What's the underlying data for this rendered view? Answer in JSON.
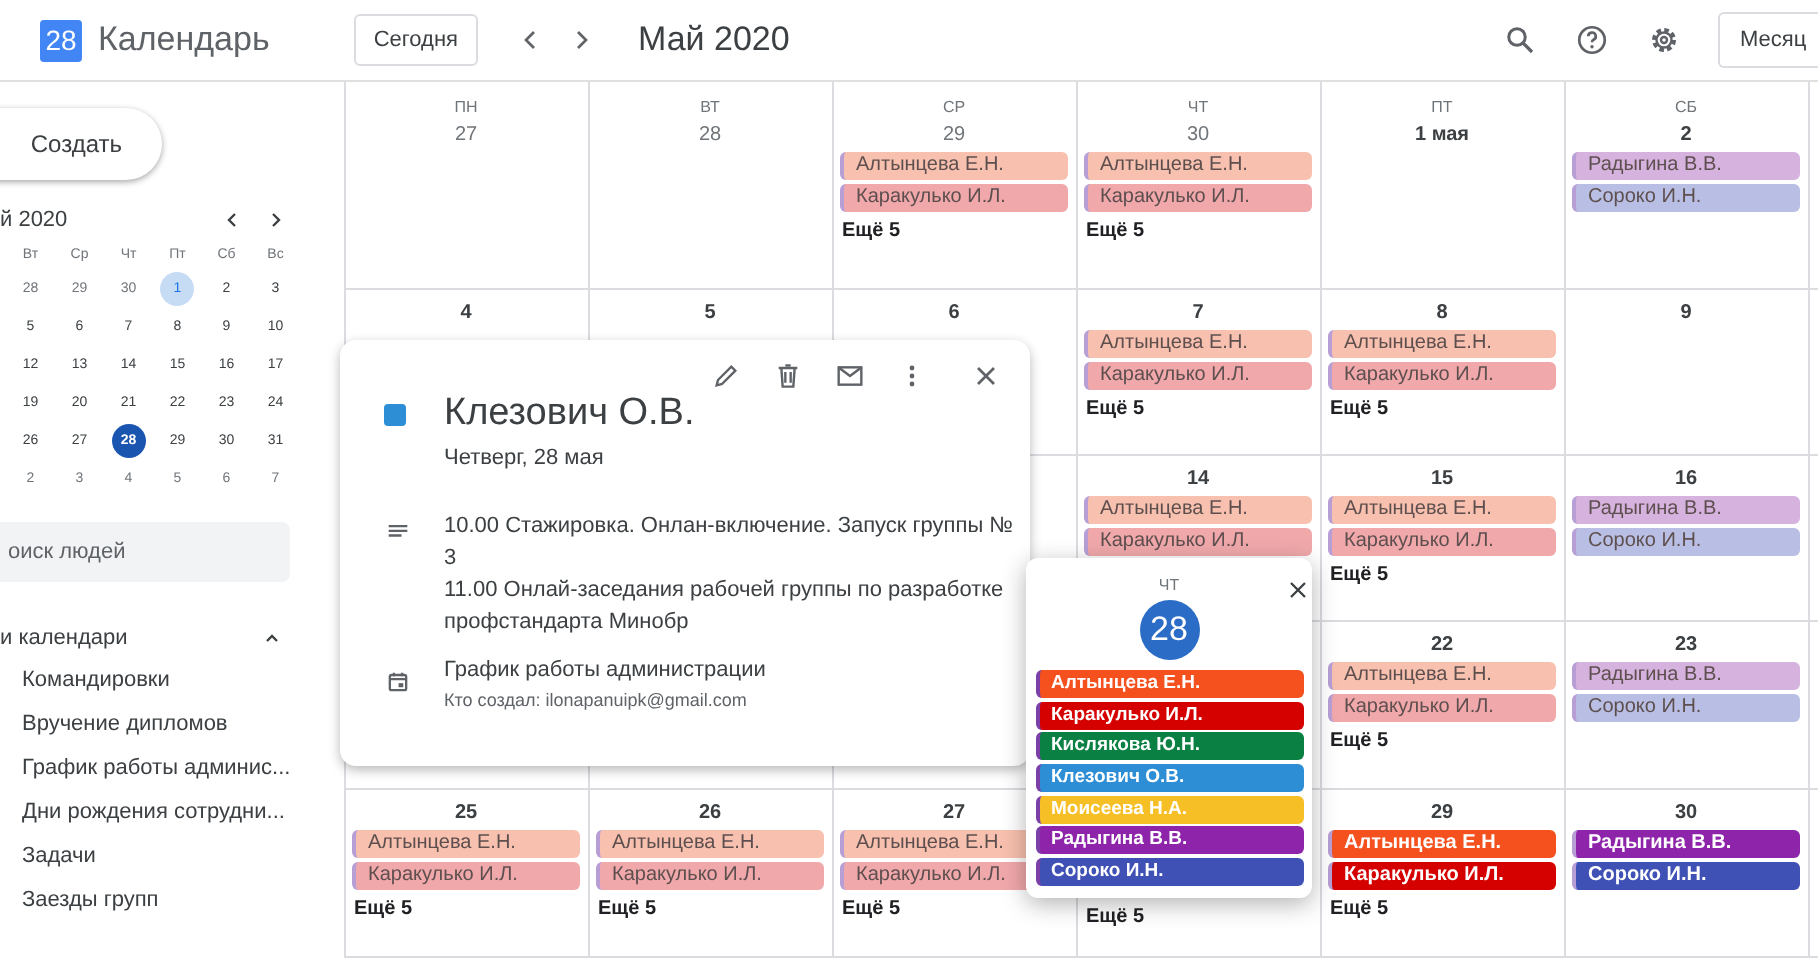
{
  "header": {
    "logo_day": "28",
    "app_title": "Календарь",
    "today_button": "Сегодня",
    "period": "Май 2020",
    "view_button": "Месяц"
  },
  "sidebar": {
    "create_button": "Создать",
    "mini_calendar": {
      "title": "й 2020",
      "weekdays": [
        "Вт",
        "Ср",
        "Чт",
        "Пт",
        "Сб",
        "Вс"
      ],
      "weeks": [
        [
          {
            "label": "28",
            "muted": true,
            "today": false,
            "selected": false
          },
          {
            "label": "29",
            "muted": true,
            "today": false,
            "selected": false
          },
          {
            "label": "30",
            "muted": true,
            "today": false,
            "selected": false
          },
          {
            "label": "1",
            "muted": false,
            "today": true,
            "selected": false
          },
          {
            "label": "2",
            "muted": false,
            "today": false,
            "selected": false
          },
          {
            "label": "3",
            "muted": false,
            "today": false,
            "selected": false
          }
        ],
        [
          {
            "label": "5",
            "muted": false,
            "today": false,
            "selected": false
          },
          {
            "label": "6",
            "muted": false,
            "today": false,
            "selected": false
          },
          {
            "label": "7",
            "muted": false,
            "today": false,
            "selected": false
          },
          {
            "label": "8",
            "muted": false,
            "today": false,
            "selected": false
          },
          {
            "label": "9",
            "muted": false,
            "today": false,
            "selected": false
          },
          {
            "label": "10",
            "muted": false,
            "today": false,
            "selected": false
          }
        ],
        [
          {
            "label": "12",
            "muted": false,
            "today": false,
            "selected": false
          },
          {
            "label": "13",
            "muted": false,
            "today": false,
            "selected": false
          },
          {
            "label": "14",
            "muted": false,
            "today": false,
            "selected": false
          },
          {
            "label": "15",
            "muted": false,
            "today": false,
            "selected": false
          },
          {
            "label": "16",
            "muted": false,
            "today": false,
            "selected": false
          },
          {
            "label": "17",
            "muted": false,
            "today": false,
            "selected": false
          }
        ],
        [
          {
            "label": "19",
            "muted": false,
            "today": false,
            "selected": false
          },
          {
            "label": "20",
            "muted": false,
            "today": false,
            "selected": false
          },
          {
            "label": "21",
            "muted": false,
            "today": false,
            "selected": false
          },
          {
            "label": "22",
            "muted": false,
            "today": false,
            "selected": false
          },
          {
            "label": "23",
            "muted": false,
            "today": false,
            "selected": false
          },
          {
            "label": "24",
            "muted": false,
            "today": false,
            "selected": false
          }
        ],
        [
          {
            "label": "26",
            "muted": false,
            "today": false,
            "selected": false
          },
          {
            "label": "27",
            "muted": false,
            "today": false,
            "selected": false
          },
          {
            "label": "28",
            "muted": false,
            "today": false,
            "selected": true
          },
          {
            "label": "29",
            "muted": false,
            "today": false,
            "selected": false
          },
          {
            "label": "30",
            "muted": false,
            "today": false,
            "selected": false
          },
          {
            "label": "31",
            "muted": false,
            "today": false,
            "selected": false
          }
        ],
        [
          {
            "label": "2",
            "muted": true,
            "today": false,
            "selected": false
          },
          {
            "label": "3",
            "muted": true,
            "today": false,
            "selected": false
          },
          {
            "label": "4",
            "muted": true,
            "today": false,
            "selected": false
          },
          {
            "label": "5",
            "muted": true,
            "today": false,
            "selected": false
          },
          {
            "label": "6",
            "muted": true,
            "today": false,
            "selected": false
          },
          {
            "label": "7",
            "muted": true,
            "today": false,
            "selected": false
          }
        ]
      ]
    },
    "people_search": {
      "placeholder": "оиск людей"
    },
    "calendars": {
      "title": "и календари",
      "expanded": true,
      "items": [
        "Командировки",
        "Вручение дипломов",
        "График работы админис...",
        "Дни рождения сотрудни...",
        "Задачи",
        "Заезды групп"
      ]
    }
  },
  "grid": {
    "weeks": [
      {
        "cells": [
          {
            "weekday": "ПН",
            "date": "27",
            "muted": true
          },
          {
            "weekday": "ВТ",
            "date": "28",
            "muted": true
          },
          {
            "weekday": "СР",
            "date": "29",
            "muted": true,
            "events": [
              {
                "name": "Алтынцева Е.Н.",
                "color": "#f8c0ae",
                "past": true
              },
              {
                "name": "Каракулько И.Л.",
                "color": "#f0a8ab",
                "past": true
              }
            ],
            "more": "Ещё 5"
          },
          {
            "weekday": "ЧТ",
            "date": "30",
            "muted": true,
            "events": [
              {
                "name": "Алтынцева Е.Н.",
                "color": "#f8c0ae",
                "past": true
              },
              {
                "name": "Каракулько И.Л.",
                "color": "#f0a8ab",
                "past": true
              }
            ],
            "more": "Ещё 5"
          },
          {
            "weekday": "ПТ",
            "date": "1 мая",
            "muted": false
          },
          {
            "weekday": "СБ",
            "date": "2",
            "muted": false,
            "events": [
              {
                "name": "Радыгина В.В.",
                "color": "#d6b2de",
                "past": true
              },
              {
                "name": "Сороко И.Н.",
                "color": "#b9bfe4",
                "past": true
              }
            ]
          }
        ]
      },
      {
        "cells": [
          {
            "date": "4",
            "muted": false
          },
          {
            "date": "5",
            "muted": false
          },
          {
            "date": "6",
            "muted": false
          },
          {
            "date": "7",
            "muted": false,
            "events": [
              {
                "name": "Алтынцева Е.Н.",
                "color": "#f8c0ae",
                "past": true
              },
              {
                "name": "Каракулько И.Л.",
                "color": "#f0a8ab",
                "past": true
              }
            ],
            "more": "Ещё 5"
          },
          {
            "date": "8",
            "muted": false,
            "events": [
              {
                "name": "Алтынцева Е.Н.",
                "color": "#f8c0ae",
                "past": true
              },
              {
                "name": "Каракулько И.Л.",
                "color": "#f0a8ab",
                "past": true
              }
            ],
            "more": "Ещё 5"
          },
          {
            "date": "9",
            "muted": false
          }
        ]
      },
      {
        "cells": [
          {},
          {},
          {},
          {
            "date": "14",
            "muted": false,
            "events": [
              {
                "name": "Алтынцева Е.Н.",
                "color": "#f8c0ae",
                "past": true
              },
              {
                "name": "Каракулько И.Л.",
                "color": "#f0a8ab",
                "past": true
              }
            ]
          },
          {
            "date": "15",
            "muted": false,
            "events": [
              {
                "name": "Алтынцева Е.Н.",
                "color": "#f8c0ae",
                "past": true
              },
              {
                "name": "Каракулько И.Л.",
                "color": "#f0a8ab",
                "past": true
              }
            ],
            "more": "Ещё 5"
          },
          {
            "date": "16",
            "muted": false,
            "events": [
              {
                "name": "Радыгина В.В.",
                "color": "#d6b2de",
                "past": true
              },
              {
                "name": "Сороко И.Н.",
                "color": "#b9bfe4",
                "past": true
              }
            ]
          }
        ]
      },
      {
        "cells": [
          {},
          {},
          {},
          {},
          {
            "date": "22",
            "muted": false,
            "events": [
              {
                "name": "Алтынцева Е.Н.",
                "color": "#f8c0ae",
                "past": true
              },
              {
                "name": "Каракулько И.Л.",
                "color": "#f0a8ab",
                "past": true
              }
            ],
            "more": "Ещё 5"
          },
          {
            "date": "23",
            "muted": false,
            "events": [
              {
                "name": "Радыгина В.В.",
                "color": "#d6b2de",
                "past": true
              },
              {
                "name": "Сороко И.Н.",
                "color": "#b9bfe4",
                "past": true
              }
            ]
          }
        ]
      },
      {
        "cells": [
          {
            "date": "25",
            "muted": false,
            "events": [
              {
                "name": "Алтынцева Е.Н.",
                "color": "#f8c0ae",
                "past": true
              },
              {
                "name": "Каракулько И.Л.",
                "color": "#f0a8ab",
                "past": true
              }
            ],
            "more": "Ещё 5"
          },
          {
            "date": "26",
            "muted": false,
            "events": [
              {
                "name": "Алтынцева Е.Н.",
                "color": "#f8c0ae",
                "past": true
              },
              {
                "name": "Каракулько И.Л.",
                "color": "#f0a8ab",
                "past": true
              }
            ],
            "more": "Ещё 5"
          },
          {
            "date": "27",
            "muted": false,
            "events": [
              {
                "name": "Алтынцева Е.Н.",
                "color": "#f8c0ae",
                "past": true
              },
              {
                "name": "Каракулько И.Л.",
                "color": "#f0a8ab",
                "past": true
              }
            ],
            "more": "Ещё 5"
          },
          {
            "more": "Ещё 5"
          },
          {
            "date": "29",
            "muted": false,
            "events": [
              {
                "name": "Алтынцева Е.Н.",
                "color": "#f4511e",
                "past": false
              },
              {
                "name": "Каракулько И.Л.",
                "color": "#d50000",
                "past": false
              }
            ],
            "more": "Ещё 5"
          },
          {
            "date": "30",
            "muted": false,
            "events": [
              {
                "name": "Радыгина В.В.",
                "color": "#8e24aa",
                "past": false
              },
              {
                "name": "Сороко И.Н.",
                "color": "#3f51b5",
                "past": false
              }
            ]
          }
        ]
      }
    ]
  },
  "event_details": {
    "color": "#2d8ed6",
    "title": "Клезович О.В.",
    "date": "Четверг, 28 мая",
    "description": [
      "10.00 Стажировка. Онлан-включение. Запуск группы № 3",
      "11.00 Онлай-заседания рабочей группы по разработке профстандарта Минобр"
    ],
    "calendar": "График работы администрации",
    "creator": "Кто создал: ilonapanuipk@gmail.com"
  },
  "day_popover": {
    "weekday": "ЧТ",
    "day": "28",
    "events": [
      {
        "name": "Алтынцева Е.Н.",
        "color": "#f4511e"
      },
      {
        "name": "Каракулько И.Л.",
        "color": "#d50000"
      },
      {
        "name": "Кислякова Ю.Н.",
        "color": "#0b8043"
      },
      {
        "name": "Клезович О.В.",
        "color": "#2d8ed6"
      },
      {
        "name": "Моисеева Н.А.",
        "color": "#f6bf26"
      },
      {
        "name": "Радыгина В.В.",
        "color": "#8e24aa"
      },
      {
        "name": "Сороко И.Н.",
        "color": "#3f51b5"
      }
    ]
  }
}
